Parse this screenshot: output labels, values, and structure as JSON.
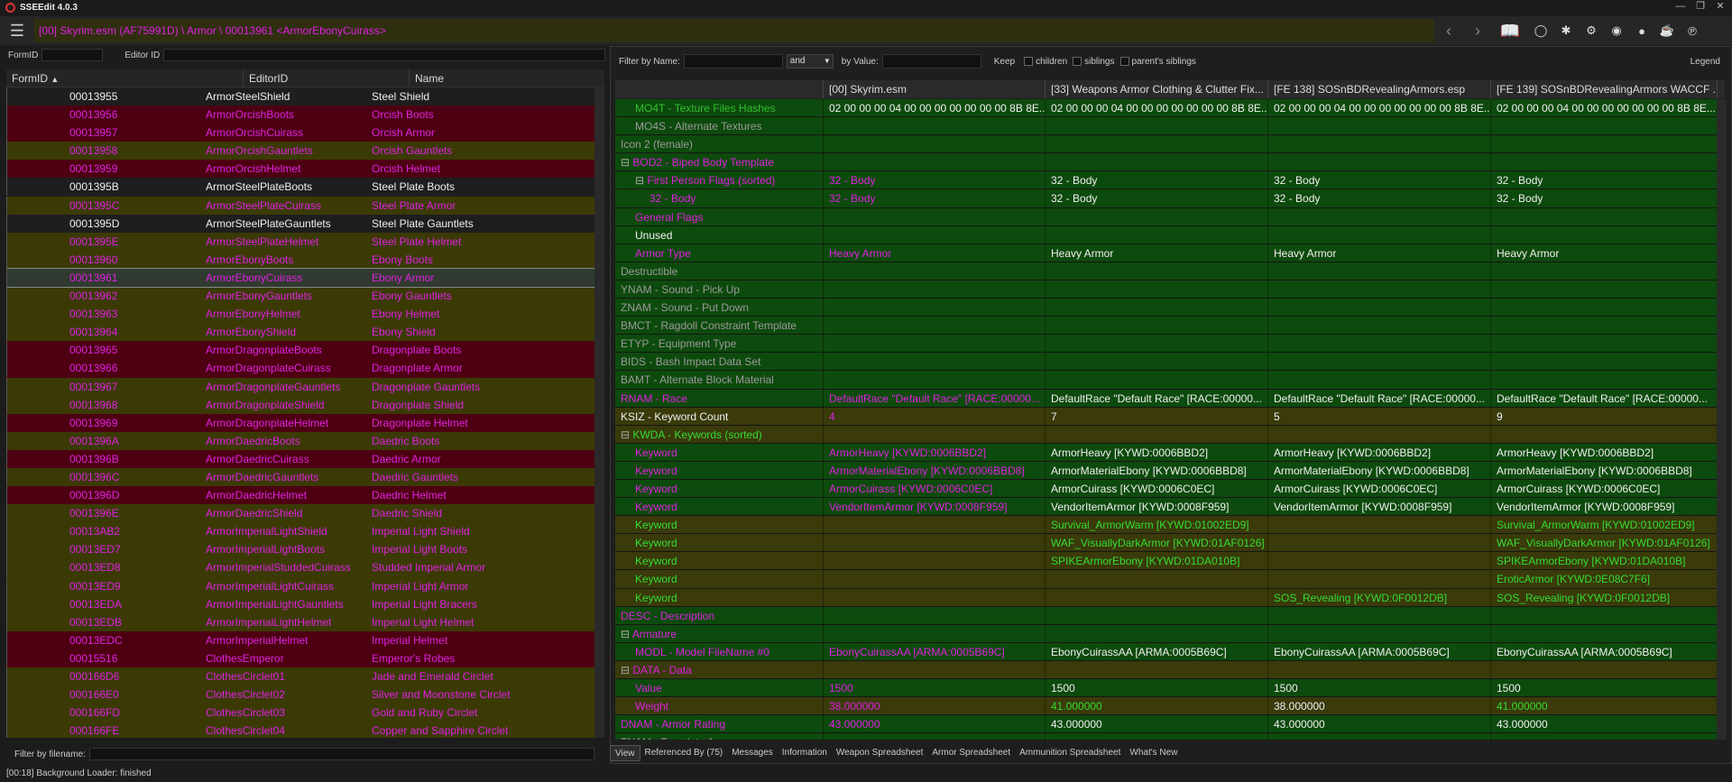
{
  "window": {
    "title": "SSEEdit 4.0.3"
  },
  "toolbar": {
    "path": "[00] Skyrim.esm (AF75991D) \\ Armor \\ 00013961 <ArmorEbonyCuirass>"
  },
  "left_filters": {
    "formid_label": "FormID",
    "editorid_label": "Editor ID"
  },
  "left_headers": {
    "formid": "FormID",
    "editorid": "EditorID",
    "name": "Name"
  },
  "left_rows": [
    {
      "id": "00013955",
      "edid": "ArmorSteelShield",
      "name": "Steel Shield",
      "style": "w"
    },
    {
      "id": "00013956",
      "edid": "ArmorOrcishBoots",
      "name": "Orcish Boots",
      "style": "r"
    },
    {
      "id": "00013957",
      "edid": "ArmorOrcishCuirass",
      "name": "Orcish Armor",
      "style": "r"
    },
    {
      "id": "00013958",
      "edid": "ArmorOrcishGauntlets",
      "name": "Orcish Gauntlets",
      "style": "o"
    },
    {
      "id": "00013959",
      "edid": "ArmorOrcishHelmet",
      "name": "Orcish Helmet",
      "style": "r"
    },
    {
      "id": "0001395B",
      "edid": "ArmorSteelPlateBoots",
      "name": "Steel Plate Boots",
      "style": "w"
    },
    {
      "id": "0001395C",
      "edid": "ArmorSteelPlateCuirass",
      "name": "Steel Plate Armor",
      "style": "o"
    },
    {
      "id": "0001395D",
      "edid": "ArmorSteelPlateGauntlets",
      "name": "Steel Plate Gauntlets",
      "style": "w"
    },
    {
      "id": "0001395E",
      "edid": "ArmorSteelPlateHelmet",
      "name": "Steel Plate Helmet",
      "style": "o"
    },
    {
      "id": "00013960",
      "edid": "ArmorEbonyBoots",
      "name": "Ebony Boots",
      "style": "o"
    },
    {
      "id": "00013961",
      "edid": "ArmorEbonyCuirass",
      "name": "Ebony Armor",
      "style": "s"
    },
    {
      "id": "00013962",
      "edid": "ArmorEbonyGauntlets",
      "name": "Ebony Gauntlets",
      "style": "o"
    },
    {
      "id": "00013963",
      "edid": "ArmorEbonyHelmet",
      "name": "Ebony Helmet",
      "style": "o"
    },
    {
      "id": "00013964",
      "edid": "ArmorEbonyShield",
      "name": "Ebony Shield",
      "style": "o"
    },
    {
      "id": "00013965",
      "edid": "ArmorDragonplateBoots",
      "name": "Dragonplate Boots",
      "style": "r"
    },
    {
      "id": "00013966",
      "edid": "ArmorDragonplateCuirass",
      "name": "Dragonplate Armor",
      "style": "r"
    },
    {
      "id": "00013967",
      "edid": "ArmorDragonplateGauntlets",
      "name": "Dragonplate Gauntlets",
      "style": "o"
    },
    {
      "id": "00013968",
      "edid": "ArmorDragonplateShield",
      "name": "Dragonplate Shield",
      "style": "o"
    },
    {
      "id": "00013969",
      "edid": "ArmorDragonplateHelmet",
      "name": "Dragonplate Helmet",
      "style": "r"
    },
    {
      "id": "0001396A",
      "edid": "ArmorDaedricBoots",
      "name": "Daedric Boots",
      "style": "o"
    },
    {
      "id": "0001396B",
      "edid": "ArmorDaedricCuirass",
      "name": "Daedric Armor",
      "style": "r"
    },
    {
      "id": "0001396C",
      "edid": "ArmorDaedricGauntlets",
      "name": "Daedric Gauntlets",
      "style": "o"
    },
    {
      "id": "0001396D",
      "edid": "ArmorDaedricHelmet",
      "name": "Daedric Helmet",
      "style": "r"
    },
    {
      "id": "0001396E",
      "edid": "ArmorDaedricShield",
      "name": "Daedric Shield",
      "style": "o"
    },
    {
      "id": "00013AB2",
      "edid": "ArmorImperialLightShield",
      "name": "Imperial Light Shield",
      "style": "o"
    },
    {
      "id": "00013ED7",
      "edid": "ArmorImperialLightBoots",
      "name": "Imperial Light Boots",
      "style": "o"
    },
    {
      "id": "00013ED8",
      "edid": "ArmorImperialStuddedCuirass",
      "name": "Studded Imperial Armor",
      "style": "o"
    },
    {
      "id": "00013ED9",
      "edid": "ArmorImperialLightCuirass",
      "name": "Imperial Light Armor",
      "style": "o"
    },
    {
      "id": "00013EDA",
      "edid": "ArmorImperialLightGauntlets",
      "name": "Imperial Light Bracers",
      "style": "o"
    },
    {
      "id": "00013EDB",
      "edid": "ArmorImperialLightHelmet",
      "name": "Imperial Light Helmet",
      "style": "o"
    },
    {
      "id": "00013EDC",
      "edid": "ArmorImperialHelmet",
      "name": "Imperial Helmet",
      "style": "r"
    },
    {
      "id": "00015516",
      "edid": "ClothesEmperor",
      "name": "Emperor's Robes",
      "style": "r"
    },
    {
      "id": "000166D6",
      "edid": "ClothesCirclet01",
      "name": "Jade and Emerald Circlet",
      "style": "o"
    },
    {
      "id": "000166E0",
      "edid": "ClothesCirclet02",
      "name": "Silver and Moonstone Circlet",
      "style": "o"
    },
    {
      "id": "000166FD",
      "edid": "ClothesCirclet03",
      "name": "Gold and Ruby Circlet",
      "style": "o"
    },
    {
      "id": "000166FE",
      "edid": "ClothesCirclet04",
      "name": "Copper and Sapphire Circlet",
      "style": "o"
    }
  ],
  "left_filename_label": "Filter by filename:",
  "status": "[00:18] Background Loader: finished",
  "right_filters": {
    "by_name": "Filter by Name:",
    "op": "and",
    "by_value": "by Value:",
    "keep": "Keep",
    "children": "children",
    "siblings": "siblings",
    "parents_siblings": "parent's siblings",
    "legend": "Legend"
  },
  "right_headers": [
    "",
    "[00] Skyrim.esm",
    "[33] Weapons Armor Clothing & Clutter Fix...",
    "[FE 138] SOSnBDRevealingArmors.esp",
    "[FE 139] SOSnBDRevealingArmors WACCF ..."
  ],
  "right_rows": [
    {
      "label": "MO4T - Texture Files Hashes",
      "indent": 2,
      "vals": [
        "02 00 00 00 04 00 00 00 00 00 00 00 8B 8E...",
        "02 00 00 00 04 00 00 00 00 00 00 00 8B 8E...",
        "02 00 00 00 04 00 00 00 00 00 00 00 8B 8E...",
        "02 00 00 00 04 00 00 00 00 00 00 00 8B 8E..."
      ],
      "bg": "g",
      "c": [
        "g",
        "w",
        "w",
        "w",
        "w"
      ]
    },
    {
      "label": "MO4S - Alternate Textures",
      "indent": 2,
      "vals": [
        "",
        "",
        "",
        ""
      ],
      "bg": "g",
      "c": [
        "d",
        "w",
        "w",
        "w",
        "w"
      ]
    },
    {
      "label": "Icon 2 (female)",
      "indent": 1,
      "vals": [
        "",
        "",
        "",
        ""
      ],
      "bg": "g",
      "c": [
        "d",
        "w",
        "w",
        "w",
        "w"
      ]
    },
    {
      "label": "BOD2 - Biped Body Template",
      "indent": 1,
      "exp": "-",
      "vals": [
        "",
        "",
        "",
        ""
      ],
      "bg": "g",
      "c": [
        "m",
        "w",
        "w",
        "w",
        "w"
      ]
    },
    {
      "label": "First Person Flags (sorted)",
      "indent": 2,
      "exp": "-",
      "vals": [
        "32 - Body",
        "32 - Body",
        "32 - Body",
        "32 - Body"
      ],
      "bg": "g",
      "c": [
        "m",
        "m",
        "w",
        "w",
        "w"
      ]
    },
    {
      "label": "32 - Body",
      "indent": 3,
      "vals": [
        "32 - Body",
        "32 - Body",
        "32 - Body",
        "32 - Body"
      ],
      "bg": "g",
      "c": [
        "m",
        "m",
        "w",
        "w",
        "w"
      ]
    },
    {
      "label": "General Flags",
      "indent": 2,
      "vals": [
        "",
        "",
        "",
        ""
      ],
      "bg": "g",
      "c": [
        "m",
        "w",
        "w",
        "w",
        "w"
      ]
    },
    {
      "label": "Unused",
      "indent": 2,
      "vals": [
        "",
        "",
        "",
        ""
      ],
      "bg": "g",
      "c": [
        "w",
        "w",
        "w",
        "w",
        "w"
      ]
    },
    {
      "label": "Armor Type",
      "indent": 2,
      "vals": [
        "Heavy Armor",
        "Heavy Armor",
        "Heavy Armor",
        "Heavy Armor"
      ],
      "bg": "g",
      "c": [
        "m",
        "m",
        "w",
        "w",
        "w"
      ]
    },
    {
      "label": "Destructible",
      "indent": 1,
      "vals": [
        "",
        "",
        "",
        ""
      ],
      "bg": "g",
      "c": [
        "d",
        "w",
        "w",
        "w",
        "w"
      ]
    },
    {
      "label": "YNAM - Sound - Pick Up",
      "indent": 1,
      "vals": [
        "",
        "",
        "",
        ""
      ],
      "bg": "g",
      "c": [
        "d",
        "w",
        "w",
        "w",
        "w"
      ]
    },
    {
      "label": "ZNAM - Sound - Put Down",
      "indent": 1,
      "vals": [
        "",
        "",
        "",
        ""
      ],
      "bg": "g",
      "c": [
        "d",
        "w",
        "w",
        "w",
        "w"
      ]
    },
    {
      "label": "BMCT - Ragdoll Constraint Template",
      "indent": 1,
      "vals": [
        "",
        "",
        "",
        ""
      ],
      "bg": "g",
      "c": [
        "d",
        "w",
        "w",
        "w",
        "w"
      ]
    },
    {
      "label": "ETYP - Equipment Type",
      "indent": 1,
      "vals": [
        "",
        "",
        "",
        ""
      ],
      "bg": "g",
      "c": [
        "d",
        "w",
        "w",
        "w",
        "w"
      ]
    },
    {
      "label": "BIDS - Bash Impact Data Set",
      "indent": 1,
      "vals": [
        "",
        "",
        "",
        ""
      ],
      "bg": "g",
      "c": [
        "d",
        "w",
        "w",
        "w",
        "w"
      ]
    },
    {
      "label": "BAMT - Alternate Block Material",
      "indent": 1,
      "vals": [
        "",
        "",
        "",
        ""
      ],
      "bg": "g",
      "c": [
        "d",
        "w",
        "w",
        "w",
        "w"
      ]
    },
    {
      "label": "RNAM - Race",
      "indent": 1,
      "vals": [
        "DefaultRace \"Default Race\" [RACE:00000...",
        "DefaultRace \"Default Race\" [RACE:00000...",
        "DefaultRace \"Default Race\" [RACE:00000...",
        "DefaultRace \"Default Race\" [RACE:00000..."
      ],
      "bg": "g",
      "c": [
        "m",
        "m",
        "w",
        "w",
        "w"
      ]
    },
    {
      "label": "KSIZ - Keyword Count",
      "indent": 1,
      "vals": [
        "4",
        "7",
        "5",
        "9"
      ],
      "bg": "o",
      "c": [
        "w",
        "m",
        "w",
        "w",
        "w"
      ]
    },
    {
      "label": "KWDA - Keywords (sorted)",
      "indent": 1,
      "exp": "-",
      "vals": [
        "",
        "",
        "",
        ""
      ],
      "bg": "o",
      "c": [
        "l",
        "w",
        "w",
        "w",
        "w"
      ]
    },
    {
      "label": "Keyword",
      "indent": 2,
      "vals": [
        "ArmorHeavy [KYWD:0006BBD2]",
        "ArmorHeavy [KYWD:0006BBD2]",
        "ArmorHeavy [KYWD:0006BBD2]",
        "ArmorHeavy [KYWD:0006BBD2]"
      ],
      "bg": "g",
      "c": [
        "m",
        "m",
        "w",
        "w",
        "w"
      ]
    },
    {
      "label": "Keyword",
      "indent": 2,
      "vals": [
        "ArmorMaterialEbony [KYWD:0006BBD8]",
        "ArmorMaterialEbony [KYWD:0006BBD8]",
        "ArmorMaterialEbony [KYWD:0006BBD8]",
        "ArmorMaterialEbony [KYWD:0006BBD8]"
      ],
      "bg": "g",
      "c": [
        "m",
        "m",
        "w",
        "w",
        "w"
      ]
    },
    {
      "label": "Keyword",
      "indent": 2,
      "vals": [
        "ArmorCuirass [KYWD:0006C0EC]",
        "ArmorCuirass [KYWD:0006C0EC]",
        "ArmorCuirass [KYWD:0006C0EC]",
        "ArmorCuirass [KYWD:0006C0EC]"
      ],
      "bg": "g",
      "c": [
        "m",
        "m",
        "w",
        "w",
        "w"
      ]
    },
    {
      "label": "Keyword",
      "indent": 2,
      "vals": [
        "VendorItemArmor [KYWD:0008F959]",
        "VendorItemArmor [KYWD:0008F959]",
        "VendorItemArmor [KYWD:0008F959]",
        "VendorItemArmor [KYWD:0008F959]"
      ],
      "bg": "g",
      "c": [
        "m",
        "m",
        "w",
        "w",
        "w"
      ]
    },
    {
      "label": "Keyword",
      "indent": 2,
      "vals": [
        "",
        "Survival_ArmorWarm [KYWD:01002ED9]",
        "",
        "Survival_ArmorWarm [KYWD:01002ED9]"
      ],
      "bg": "o",
      "c": [
        "l",
        "w",
        "l",
        "w",
        "l"
      ]
    },
    {
      "label": "Keyword",
      "indent": 2,
      "vals": [
        "",
        "WAF_VisuallyDarkArmor [KYWD:01AF0126]",
        "",
        "WAF_VisuallyDarkArmor [KYWD:01AF0126]"
      ],
      "bg": "o",
      "c": [
        "l",
        "w",
        "l",
        "w",
        "l"
      ]
    },
    {
      "label": "Keyword",
      "indent": 2,
      "vals": [
        "",
        "SPIKEArmorEbony [KYWD:01DA010B]",
        "",
        "SPIKEArmorEbony [KYWD:01DA010B]"
      ],
      "bg": "o",
      "c": [
        "l",
        "w",
        "l",
        "w",
        "l"
      ]
    },
    {
      "label": "Keyword",
      "indent": 2,
      "vals": [
        "",
        "",
        "",
        "EroticArmor [KYWD:0E08C7F6]"
      ],
      "bg": "o",
      "c": [
        "l",
        "w",
        "w",
        "w",
        "l"
      ]
    },
    {
      "label": "Keyword",
      "indent": 2,
      "vals": [
        "",
        "",
        "SOS_Revealing [KYWD:0F0012DB]",
        "SOS_Revealing [KYWD:0F0012DB]"
      ],
      "bg": "o",
      "c": [
        "l",
        "w",
        "w",
        "l",
        "l"
      ]
    },
    {
      "label": "DESC - Description",
      "indent": 1,
      "vals": [
        "",
        "",
        "",
        ""
      ],
      "bg": "g",
      "c": [
        "m",
        "w",
        "w",
        "w",
        "w"
      ]
    },
    {
      "label": "Armature",
      "indent": 1,
      "exp": "-",
      "vals": [
        "",
        "",
        "",
        ""
      ],
      "bg": "g",
      "c": [
        "m",
        "w",
        "w",
        "w",
        "w"
      ]
    },
    {
      "label": "MODL - Model FileName #0",
      "indent": 2,
      "vals": [
        "EbonyCuirassAA [ARMA:0005B69C]",
        "EbonyCuirassAA [ARMA:0005B69C]",
        "EbonyCuirassAA [ARMA:0005B69C]",
        "EbonyCuirassAA [ARMA:0005B69C]"
      ],
      "bg": "g",
      "c": [
        "m",
        "m",
        "w",
        "w",
        "w"
      ]
    },
    {
      "label": "DATA - Data",
      "indent": 1,
      "exp": "-",
      "vals": [
        "",
        "",
        "",
        ""
      ],
      "bg": "o",
      "c": [
        "m",
        "w",
        "w",
        "w",
        "w"
      ]
    },
    {
      "label": "Value",
      "indent": 2,
      "vals": [
        "1500",
        "1500",
        "1500",
        "1500"
      ],
      "bg": "g",
      "c": [
        "m",
        "m",
        "w",
        "w",
        "w"
      ]
    },
    {
      "label": "Weight",
      "indent": 2,
      "vals": [
        "38.000000",
        "41.000000",
        "38.000000",
        "41.000000"
      ],
      "bg": "o",
      "c": [
        "m",
        "m",
        "l",
        "w",
        "l"
      ]
    },
    {
      "label": "DNAM - Armor Rating",
      "indent": 1,
      "vals": [
        "43.000000",
        "43.000000",
        "43.000000",
        "43.000000"
      ],
      "bg": "g",
      "c": [
        "m",
        "m",
        "w",
        "w",
        "w"
      ]
    },
    {
      "label": "TNAM - Template Armor",
      "indent": 1,
      "vals": [
        "",
        "",
        "",
        ""
      ],
      "bg": "g",
      "c": [
        "d",
        "w",
        "w",
        "w",
        "w"
      ]
    }
  ],
  "tabs": [
    "View",
    "Referenced By (75)",
    "Messages",
    "Information",
    "Weapon Spreadsheet",
    "Armor Spreadsheet",
    "Ammunition Spreadsheet",
    "What's New"
  ],
  "colors": {
    "row_red": "#4d0012",
    "row_olive": "#3b3a05",
    "row_white": "#1e1e1e",
    "text_magenta": "#e020e0",
    "text_white": "#f0f0f0",
    "text_lime": "#33dd33",
    "cell_green": "#0d4a0d",
    "cell_olive": "#3a3a0a"
  }
}
